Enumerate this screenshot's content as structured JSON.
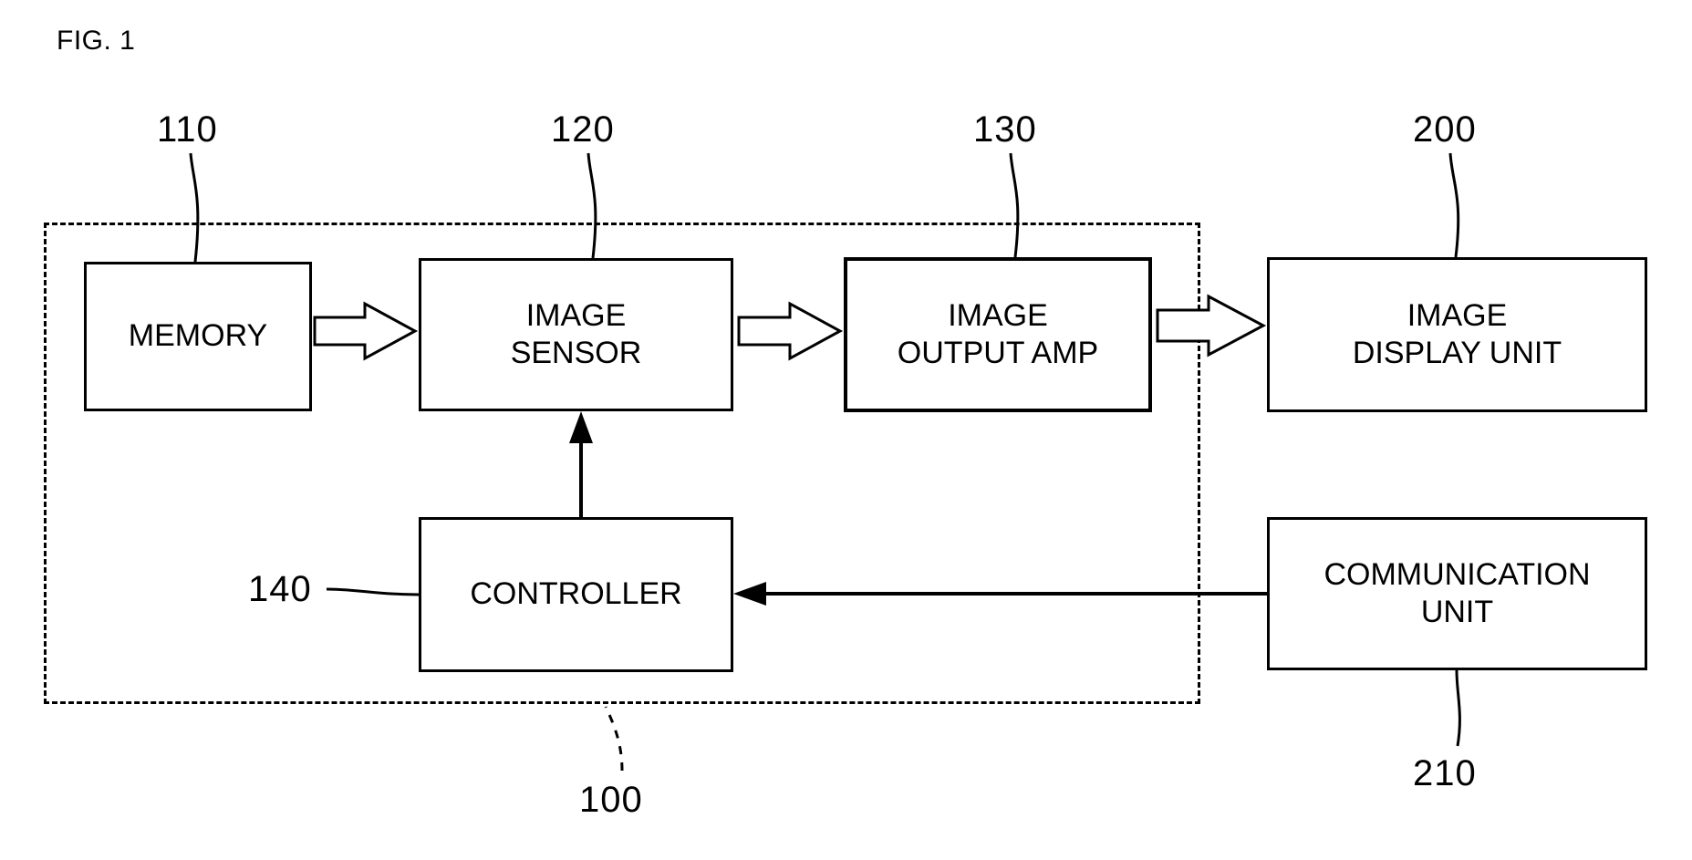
{
  "figure": {
    "label": "FIG. 1"
  },
  "blocks": [
    {
      "id": "memory",
      "lines": [
        "MEMORY"
      ],
      "ref": "110"
    },
    {
      "id": "image-sensor",
      "lines": [
        "IMAGE",
        "SENSOR"
      ],
      "ref": "120"
    },
    {
      "id": "image-output-amp",
      "lines": [
        "IMAGE",
        "OUTPUT AMP"
      ],
      "ref": "130"
    },
    {
      "id": "image-display-unit",
      "lines": [
        "IMAGE",
        "DISPLAY UNIT"
      ],
      "ref": "200"
    },
    {
      "id": "controller",
      "lines": [
        "CONTROLLER"
      ],
      "ref": "140"
    },
    {
      "id": "communication-unit",
      "lines": [
        "COMMUNICATION",
        "UNIT"
      ],
      "ref": "210"
    }
  ],
  "labels": {
    "memory_line1": "MEMORY",
    "sensor_line1": "IMAGE",
    "sensor_line2": "SENSOR",
    "amp_line1": "IMAGE",
    "amp_line2": "OUTPUT AMP",
    "display_line1": "IMAGE",
    "display_line2": "DISPLAY UNIT",
    "controller_line1": "CONTROLLER",
    "comm_line1": "COMMUNICATION",
    "comm_line2": "UNIT"
  },
  "refs": {
    "memory": "110",
    "sensor": "120",
    "amp": "130",
    "display": "200",
    "controller": "140",
    "comm": "210",
    "system": "100"
  }
}
